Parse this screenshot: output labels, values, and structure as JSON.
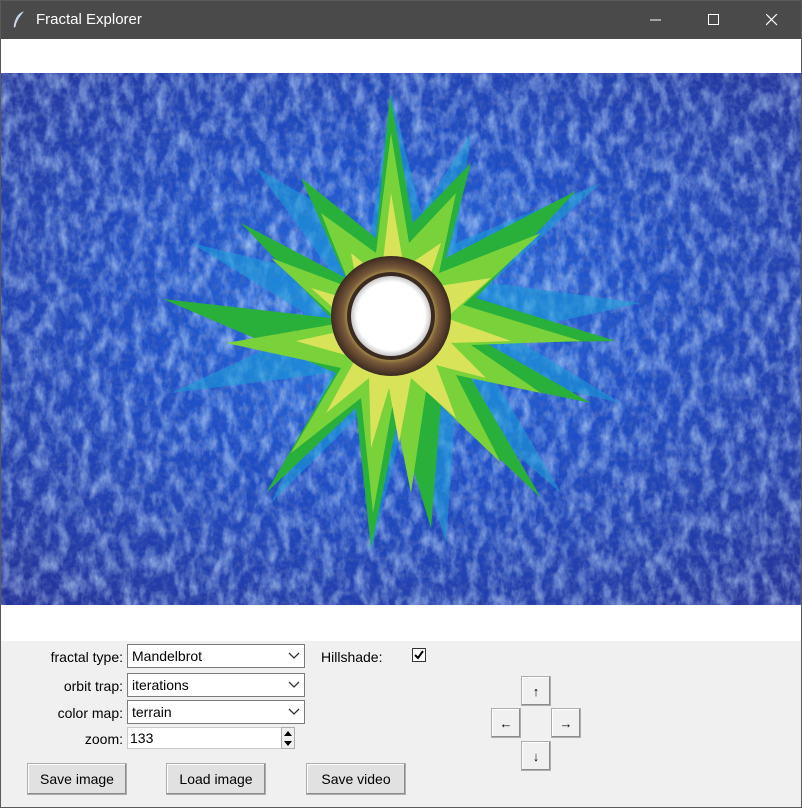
{
  "window": {
    "title": "Fractal Explorer"
  },
  "controls": {
    "fractal_type": {
      "label": "fractal type:",
      "value": "Mandelbrot"
    },
    "orbit_trap": {
      "label": "orbit trap:",
      "value": "iterations"
    },
    "color_map": {
      "label": "color map:",
      "value": "terrain"
    },
    "zoom": {
      "label": "zoom:",
      "value": "133"
    },
    "hillshade": {
      "label": "Hillshade:",
      "checked": true
    }
  },
  "buttons": {
    "save_image": "Save image",
    "load_image": "Load image",
    "save_video": "Save video"
  },
  "nav": {
    "up": "↑",
    "down": "↓",
    "left": "←",
    "right": "→"
  },
  "colors": {
    "titlebar": "#4a4a4a",
    "fractal_deep": "#1a3a9a",
    "fractal_mid": "#1f7fd6",
    "fractal_green": "#2fb02f",
    "fractal_yellow": "#f2f07a"
  }
}
